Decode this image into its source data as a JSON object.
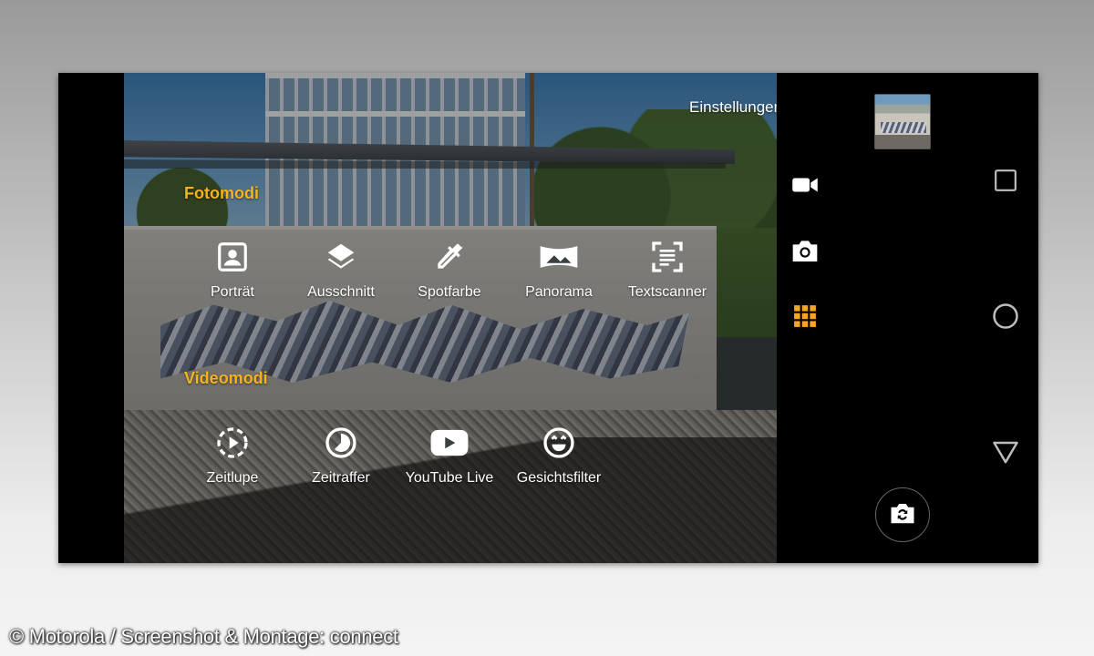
{
  "settings": {
    "label": "Einstellungen",
    "icon": "gear-icon"
  },
  "photo_modes": {
    "title": "Fotomodi",
    "items": [
      {
        "label": "Porträt",
        "icon": "portrait-icon"
      },
      {
        "label": "Ausschnitt",
        "icon": "layers-icon"
      },
      {
        "label": "Spotfarbe",
        "icon": "eyedropper-icon"
      },
      {
        "label": "Panorama",
        "icon": "panorama-icon"
      },
      {
        "label": "Textscanner",
        "icon": "text-scan-icon"
      }
    ]
  },
  "video_modes": {
    "title": "Videomodi",
    "items": [
      {
        "label": "Zeitlupe",
        "icon": "slow-motion-icon"
      },
      {
        "label": "Zeitraffer",
        "icon": "timelapse-icon"
      },
      {
        "label": "YouTube Live",
        "icon": "youtube-icon"
      },
      {
        "label": "Gesichtsfilter",
        "icon": "face-filter-icon"
      }
    ]
  },
  "side_controls": [
    {
      "name": "video",
      "icon": "video-camera-icon",
      "active": false
    },
    {
      "name": "photo",
      "icon": "camera-icon",
      "active": false
    },
    {
      "name": "modes",
      "icon": "grid-icon",
      "active": true,
      "accent": "#f5a623"
    }
  ],
  "nav_bar": [
    "recents-button",
    "home-button",
    "back-button"
  ],
  "colors": {
    "accent": "#f5b21c",
    "panel": "#000000"
  },
  "credit": "© Motorola / Screenshot & Montage: connect"
}
